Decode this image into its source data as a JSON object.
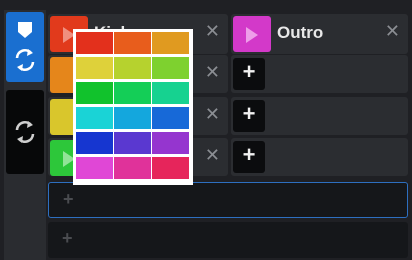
{
  "clips": {
    "kick_label": "Kick",
    "outro_label": "Outro",
    "close_glyph": "✕",
    "add_glyph": "+"
  },
  "empty_rows": {
    "add_glyph": "+"
  },
  "icons": {
    "play": "play-icon",
    "close": "close-icon",
    "add": "plus-icon",
    "sync": "sync-icon",
    "marker": "marker-icon"
  },
  "palette": {
    "title": "",
    "colors": [
      "#e3301c",
      "#e85d1c",
      "#e09a20",
      "#ded13a",
      "#b6d22e",
      "#7ed12f",
      "#11c22c",
      "#14ce57",
      "#16d290",
      "#1ad3d6",
      "#14a7dd",
      "#1769d8",
      "#1636d0",
      "#5a38d0",
      "#9535cf",
      "#e047d6",
      "#e0329a",
      "#e6255b"
    ]
  },
  "colors": {
    "active_tab": "#1a6fd0",
    "selected_row_border": "#2d6fc0"
  }
}
